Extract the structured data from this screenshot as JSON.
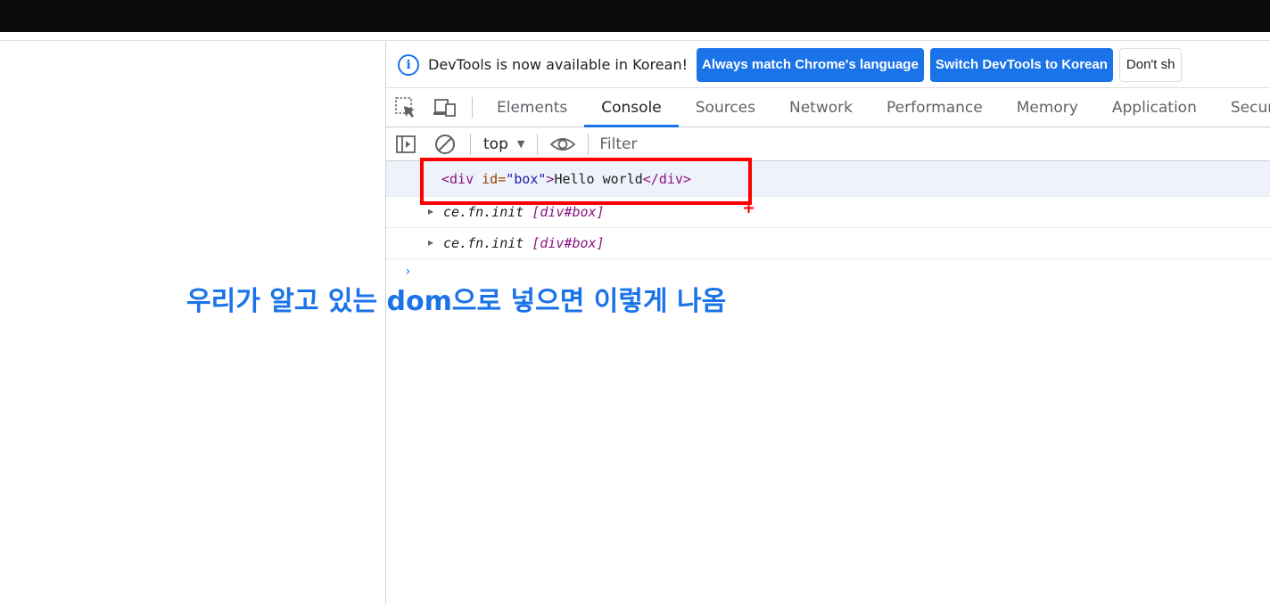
{
  "infobar": {
    "message": "DevTools is now available in Korean!",
    "button_match": "Always match Chrome's language",
    "button_switch": "Switch DevTools to Korean",
    "button_dont_show": "Don't sh"
  },
  "tabs": [
    "Elements",
    "Console",
    "Sources",
    "Network",
    "Performance",
    "Memory",
    "Application",
    "Secur"
  ],
  "active_tab": "Console",
  "console_toolbar": {
    "context": "top",
    "filter_placeholder": "Filter"
  },
  "log": {
    "row1": {
      "open": "<div",
      "attr_name": "id=",
      "attr_value": "\"box\"",
      "close_open": ">",
      "text": "Hello world",
      "end_tag": "</div>"
    },
    "row2": {
      "prefix": "ce.fn.init ",
      "detail": "[div#box]"
    },
    "row3": {
      "prefix": "ce.fn.init ",
      "detail": "[div#box]"
    }
  },
  "annotation": "우리가 알고 있는 dom으로 넣으면 이렇게 나옴",
  "colors": {
    "accent": "#1a73e8",
    "highlight": "#ff0000"
  },
  "icons": [
    "info-icon",
    "inspect-element-icon",
    "device-toggle-icon",
    "sidebar-toggle-icon",
    "clear-console-icon",
    "dropdown-arrow-icon",
    "eye-icon",
    "expand-arrow-icon",
    "prompt-chevron-icon"
  ]
}
